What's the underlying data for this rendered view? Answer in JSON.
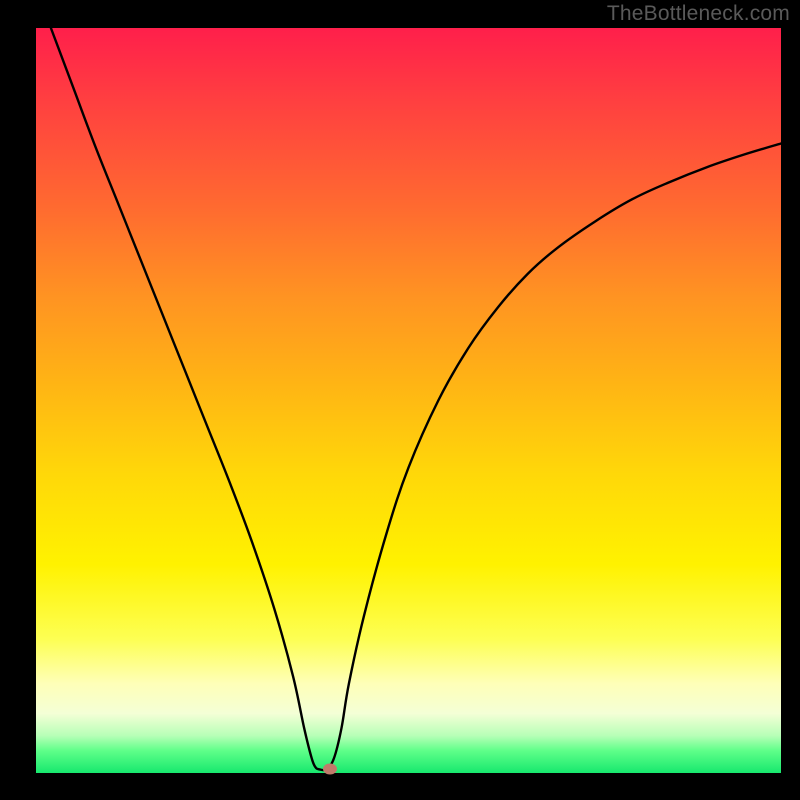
{
  "watermark": "TheBottleneck.com",
  "chart_data": {
    "type": "line",
    "title": "",
    "xlabel": "",
    "ylabel": "",
    "xlim": [
      0,
      100
    ],
    "ylim": [
      0,
      100
    ],
    "x": [
      2,
      5,
      8,
      11,
      14,
      17,
      20,
      23,
      26,
      29,
      32,
      34.5,
      36,
      37,
      37.5,
      38,
      39,
      40,
      41,
      42,
      44,
      47,
      50,
      54,
      58,
      62,
      66,
      70,
      75,
      80,
      85,
      90,
      95,
      100
    ],
    "values": [
      100,
      92,
      84,
      76.5,
      69,
      61.5,
      54,
      46.5,
      39,
      31,
      22,
      13,
      6,
      2,
      0.8,
      0.5,
      0.5,
      2,
      6,
      12,
      21,
      32,
      41,
      50,
      57,
      62.5,
      67,
      70.5,
      74,
      77,
      79.3,
      81.3,
      83,
      84.5
    ],
    "marker": {
      "x": 39.5,
      "y": 0.6
    },
    "colors": {
      "top": "#ff1f4b",
      "mid": "#ffd500",
      "bottom": "#17e86e",
      "line": "#000000",
      "marker": "#c07a6a"
    }
  }
}
